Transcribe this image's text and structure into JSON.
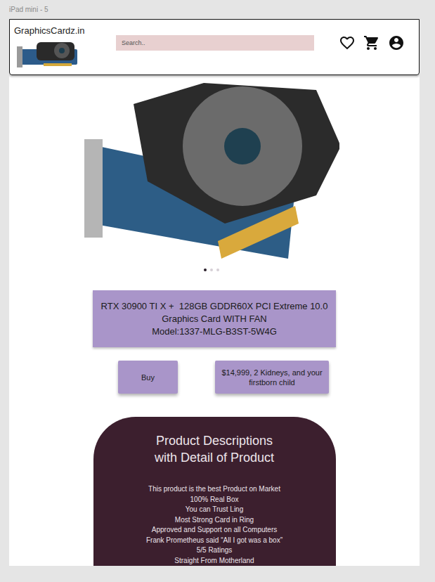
{
  "frame": {
    "label": "iPad mini - 5"
  },
  "header": {
    "logo": "GraphicsCardz.in",
    "search": {
      "placeholder": "Search.."
    }
  },
  "carousel": {
    "dots": [
      {
        "selected": true
      },
      {
        "selected": false
      },
      {
        "selected": false
      }
    ]
  },
  "product": {
    "title": "RTX 30900 TI X +  128GB GDDR60X PCI Extreme 10.0 Graphics Card WITH FAN",
    "model": "Model:1337-MLG-B3ST-5W4G"
  },
  "buttons": [
    "Buy",
    "$14,999, 2 Kidneys, and your firstborn child"
  ],
  "description": {
    "title": "Product Descriptions\nwith Detail of Product",
    "lines": [
      "This product is the best Product on Market",
      "100% Real Box",
      "You can Trust Ling",
      "Most Strong Card in Ring",
      "Approved and Support on all Computers",
      "Frank Prometheus said “All I got was a box”",
      "5/5 Ratings",
      "Straight From Motherland"
    ]
  }
}
